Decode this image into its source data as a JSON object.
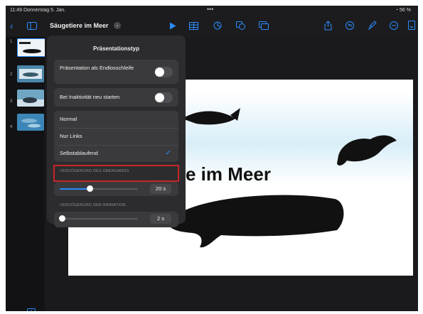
{
  "status_bar": {
    "time_date": "11:49  Donnerstag 5. Jan.",
    "more": "•••",
    "battery": "56 %"
  },
  "toolbar": {
    "doc_title": "Säugetiere im Meer",
    "title_chevron": "⌄",
    "icons": [
      "back-icon",
      "sidebar-toggle-icon",
      "play-icon",
      "table-icon",
      "chart-icon",
      "shapes-icon",
      "media-icon",
      "share-icon",
      "undo-icon",
      "format-brush-icon",
      "more-icon",
      "document-icon"
    ]
  },
  "slides": {
    "numbers": [
      "1",
      "2",
      "3",
      "4"
    ]
  },
  "slide": {
    "title": "e im Meer"
  },
  "popover": {
    "title": "Präsentationstyp",
    "loop_label": "Präsentation als Endlosschleife",
    "restart_label": "Bei Inaktivität neu starten",
    "types": [
      "Normal",
      "Nur Links",
      "Selbstablaufend"
    ],
    "selected_type": "Selbstablaufend",
    "checkmark": "✓",
    "transition_delay_label": "VERZÖGERUNG DES ÜBERGANGS",
    "transition_delay_value": "20 s",
    "transition_delay_fraction": 0.38,
    "animation_delay_label": "VERZÖGERUNG DER ANIMATION",
    "animation_delay_value": "2 s",
    "animation_delay_fraction": 0.03
  },
  "colors": {
    "accent": "#2b8cff",
    "highlight_box": "#c8242b",
    "popover_bg": "#2c2c2e"
  }
}
